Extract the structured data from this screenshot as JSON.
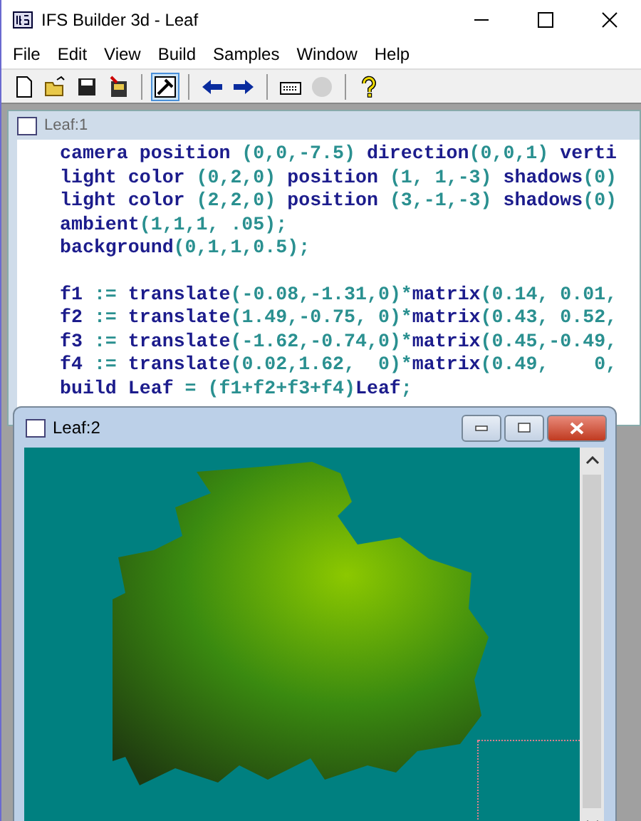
{
  "window": {
    "title": "IFS Builder 3d - Leaf"
  },
  "menu": [
    "File",
    "Edit",
    "View",
    "Build",
    "Samples",
    "Window",
    "Help"
  ],
  "toolbar": [
    {
      "kind": "new",
      "selected": false
    },
    {
      "kind": "open",
      "selected": false
    },
    {
      "kind": "save",
      "selected": false
    },
    {
      "kind": "export",
      "selected": false
    },
    {
      "kind": "sep"
    },
    {
      "kind": "build",
      "selected": true
    },
    {
      "kind": "sep"
    },
    {
      "kind": "back",
      "selected": false
    },
    {
      "kind": "forward",
      "selected": false
    },
    {
      "kind": "sep"
    },
    {
      "kind": "keyboard",
      "selected": false
    },
    {
      "kind": "stop",
      "selected": false,
      "disabled": true
    },
    {
      "kind": "sep"
    },
    {
      "kind": "help",
      "selected": false
    }
  ],
  "editor": {
    "title": "Leaf:1",
    "blocks": [
      [
        [
          {
            "text": "camera position ",
            "kind": "kw"
          },
          {
            "text": "(0,0,-7.5) ",
            "kind": "lit"
          },
          {
            "text": "direction",
            "kind": "kw"
          },
          {
            "text": "(0,0,1) ",
            "kind": "lit"
          },
          {
            "text": "verti",
            "kind": "kw"
          }
        ],
        [
          {
            "text": "light color ",
            "kind": "kw"
          },
          {
            "text": "(0,2,0) ",
            "kind": "lit"
          },
          {
            "text": "position ",
            "kind": "kw"
          },
          {
            "text": "(1, 1,-3) ",
            "kind": "lit"
          },
          {
            "text": "shadows",
            "kind": "kw"
          },
          {
            "text": "(0)",
            "kind": "lit"
          }
        ],
        [
          {
            "text": "light color ",
            "kind": "kw"
          },
          {
            "text": "(2,2,0) ",
            "kind": "lit"
          },
          {
            "text": "position ",
            "kind": "kw"
          },
          {
            "text": "(3,-1,-3) ",
            "kind": "lit"
          },
          {
            "text": "shadows",
            "kind": "kw"
          },
          {
            "text": "(0)",
            "kind": "lit"
          }
        ],
        [
          {
            "text": "ambient",
            "kind": "kw"
          },
          {
            "text": "(1,1,1, .05);",
            "kind": "lit"
          }
        ],
        [
          {
            "text": "background",
            "kind": "kw"
          },
          {
            "text": "(0,1,1,0.5);",
            "kind": "lit"
          }
        ]
      ],
      [
        [
          {
            "text": "f1 ",
            "kind": "kw"
          },
          {
            "text": ":= ",
            "kind": "lit"
          },
          {
            "text": "translate",
            "kind": "kw"
          },
          {
            "text": "(-0.08,-1.31,0)*",
            "kind": "lit"
          },
          {
            "text": "matrix",
            "kind": "kw"
          },
          {
            "text": "(0.14, 0.01,",
            "kind": "lit"
          }
        ],
        [
          {
            "text": "f2 ",
            "kind": "kw"
          },
          {
            "text": ":= ",
            "kind": "lit"
          },
          {
            "text": "translate",
            "kind": "kw"
          },
          {
            "text": "(1.49,-0.75, 0)*",
            "kind": "lit"
          },
          {
            "text": "matrix",
            "kind": "kw"
          },
          {
            "text": "(0.43, 0.52,",
            "kind": "lit"
          }
        ],
        [
          {
            "text": "f3 ",
            "kind": "kw"
          },
          {
            "text": ":= ",
            "kind": "lit"
          },
          {
            "text": "translate",
            "kind": "kw"
          },
          {
            "text": "(-1.62,-0.74,0)*",
            "kind": "lit"
          },
          {
            "text": "matrix",
            "kind": "kw"
          },
          {
            "text": "(0.45,-0.49,",
            "kind": "lit"
          }
        ],
        [
          {
            "text": "f4 ",
            "kind": "kw"
          },
          {
            "text": ":= ",
            "kind": "lit"
          },
          {
            "text": "translate",
            "kind": "kw"
          },
          {
            "text": "(0.02,1.62,  0)*",
            "kind": "lit"
          },
          {
            "text": "matrix",
            "kind": "kw"
          },
          {
            "text": "(0.49,    0,",
            "kind": "lit"
          }
        ],
        [
          {
            "text": "build Leaf ",
            "kind": "kw"
          },
          {
            "text": "= (f1+f2+f3+f4)",
            "kind": "lit"
          },
          {
            "text": "Leaf",
            "kind": "kw"
          },
          {
            "text": ";",
            "kind": "lit"
          }
        ]
      ]
    ]
  },
  "viewer": {
    "title": "Leaf:2"
  }
}
